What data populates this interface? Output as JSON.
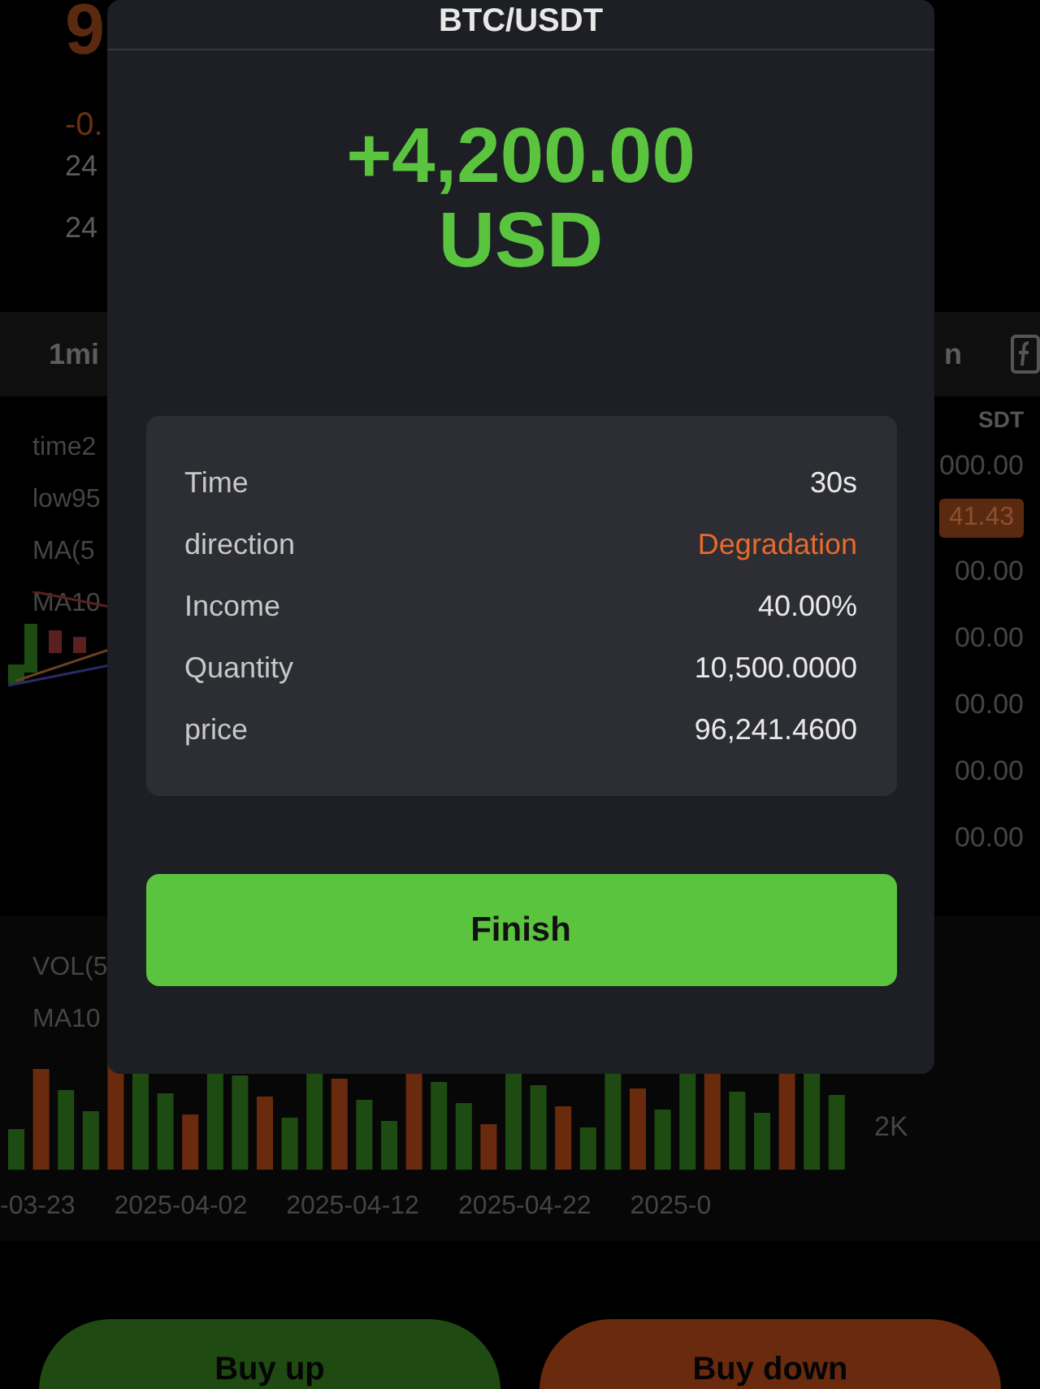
{
  "header": {
    "price": "9",
    "change": "-0.",
    "stats": [
      "24",
      "24"
    ]
  },
  "timeframes": [
    {
      "label": "1mi",
      "selected": false
    },
    {
      "label": "n",
      "selected": false
    }
  ],
  "chart": {
    "legend": [
      "time2",
      "low95",
      "MA(5",
      "MA10"
    ],
    "axis_title": "SDT",
    "axis_labels": [
      "000.00",
      "00.00",
      "00.00",
      "00.00",
      "00.00",
      "00.00"
    ],
    "current_price": "41.43"
  },
  "volume": {
    "legend": [
      "VOL(5",
      "MA10"
    ],
    "axis_label": "2K",
    "dates": [
      "-03-23",
      "2025-04-02",
      "2025-04-12",
      "2025-04-22",
      "2025-0"
    ]
  },
  "actions": [
    {
      "label": "Buy up",
      "kind": "up"
    },
    {
      "label": "Buy down",
      "kind": "down"
    }
  ],
  "dialog": {
    "title": "BTC/USDT",
    "amount": "+4,200.00",
    "currency": "USD",
    "details": [
      {
        "label": "Time",
        "value": "30s",
        "kind": "plain"
      },
      {
        "label": "direction",
        "value": "Degradation",
        "kind": "down"
      },
      {
        "label": "Income",
        "value": "40.00%",
        "kind": "plain"
      },
      {
        "label": "Quantity",
        "value": "10,500.0000",
        "kind": "plain"
      },
      {
        "label": "price",
        "value": "96,241.4600",
        "kind": "plain"
      }
    ],
    "button": "Finish"
  }
}
